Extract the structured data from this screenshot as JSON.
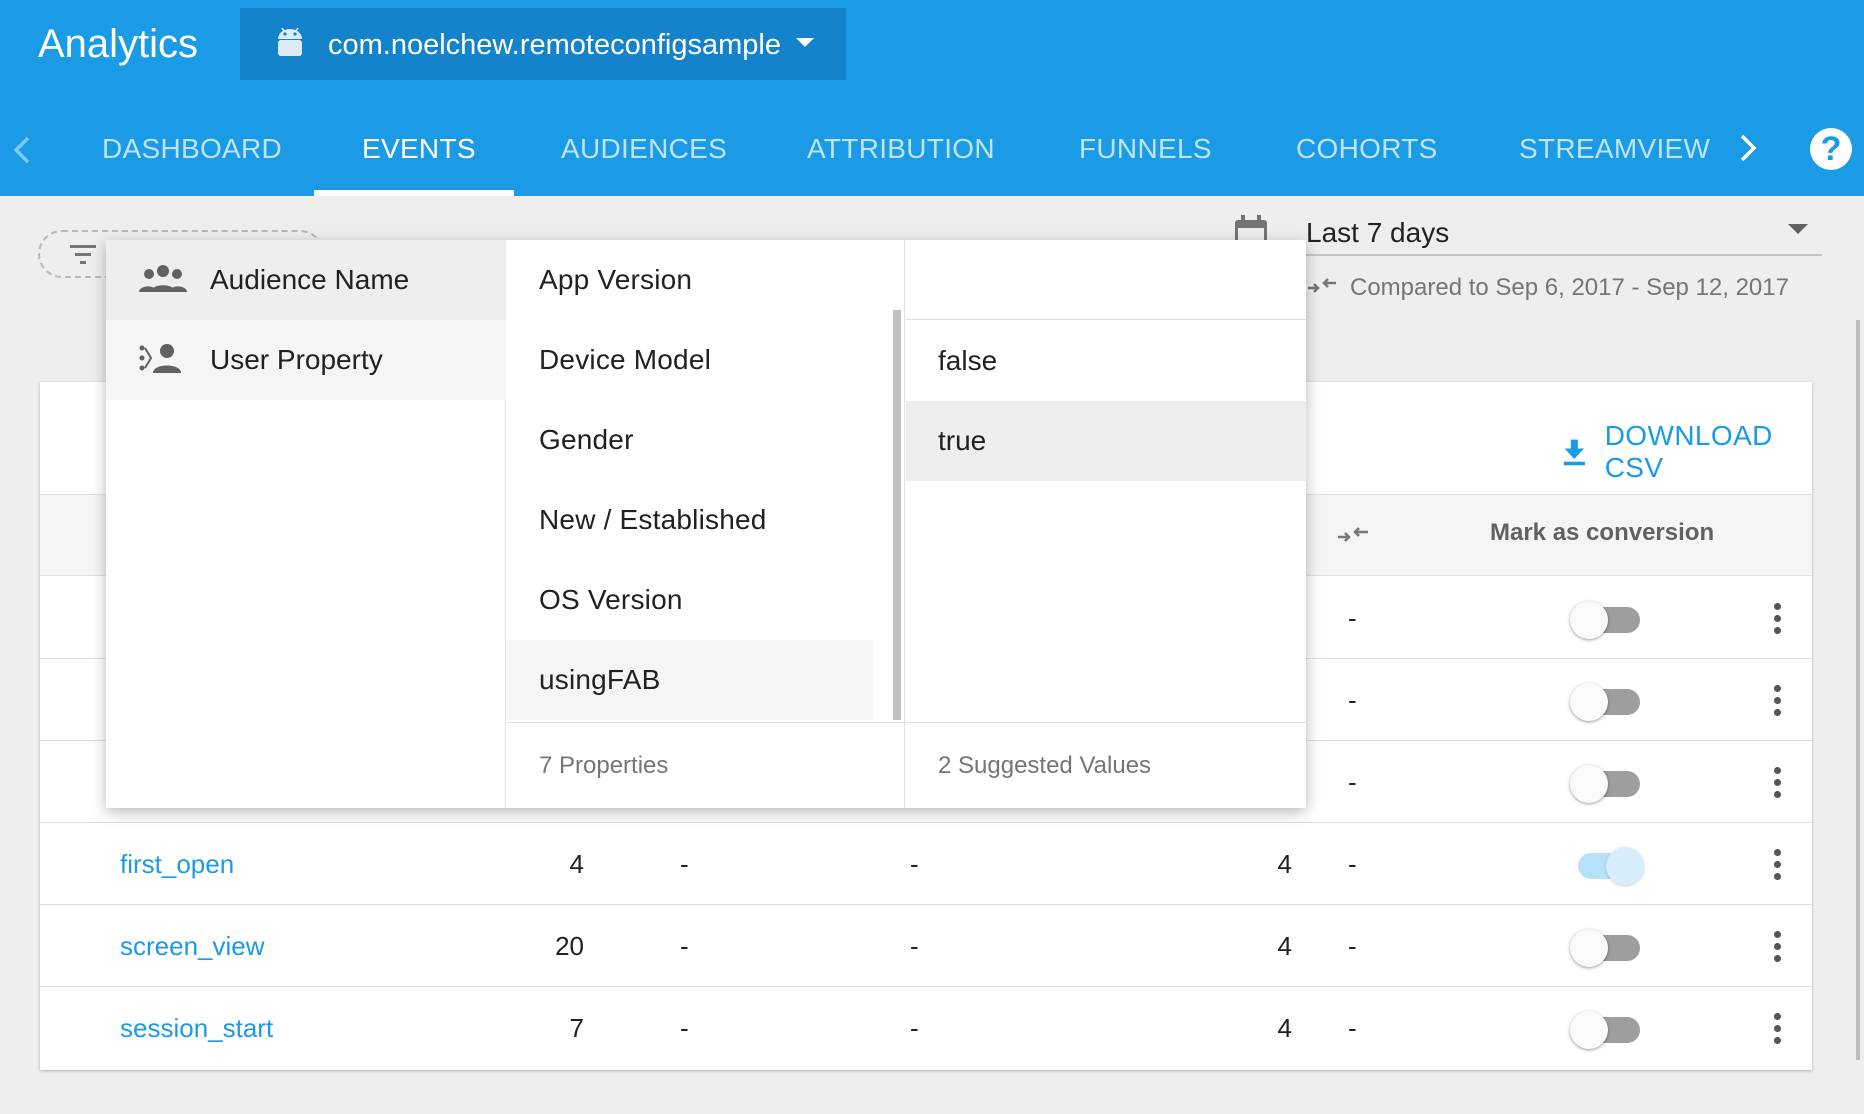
{
  "header": {
    "app_title": "Analytics",
    "app_name": "com.noelchew.remoteconfigsample",
    "tabs": [
      {
        "label": "DASHBOARD"
      },
      {
        "label": "EVENTS"
      },
      {
        "label": "AUDIENCES"
      },
      {
        "label": "ATTRIBUTION"
      },
      {
        "label": "FUNNELS"
      },
      {
        "label": "COHORTS"
      },
      {
        "label": "STREAMVIEW"
      }
    ],
    "active_tab": "EVENTS",
    "help_label": "?"
  },
  "date_filter": {
    "range": "Last 7 days",
    "compared_to": "Compared to Sep 6, 2017 - Sep 12, 2017"
  },
  "events_card": {
    "download_label": "DOWNLOAD CSV",
    "mark_as_conversion_header": "Mark as conversion",
    "rows": [
      {
        "name": "",
        "count": "",
        "d1": "",
        "d2": "",
        "users": "",
        "d3": "-",
        "conversion": false
      },
      {
        "name": "",
        "count": "",
        "d1": "",
        "d2": "",
        "users": "",
        "d3": "-",
        "conversion": false
      },
      {
        "name": "",
        "count": "",
        "d1": "",
        "d2": "",
        "users": "",
        "d3": "-",
        "conversion": false
      },
      {
        "name": "first_open",
        "count": "4",
        "d1": "-",
        "d2": "-",
        "users": "4",
        "d3": "-",
        "conversion": true
      },
      {
        "name": "screen_view",
        "count": "20",
        "d1": "-",
        "d2": "-",
        "users": "4",
        "d3": "-",
        "conversion": false
      },
      {
        "name": "session_start",
        "count": "7",
        "d1": "-",
        "d2": "-",
        "users": "4",
        "d3": "-",
        "conversion": false
      }
    ]
  },
  "filter_dropdown": {
    "categories": [
      {
        "label": "Audience Name",
        "icon": "group-icon"
      },
      {
        "label": "User Property",
        "icon": "user-property-icon"
      }
    ],
    "properties": [
      {
        "label": "App Version"
      },
      {
        "label": "Device Model"
      },
      {
        "label": "Gender"
      },
      {
        "label": "New / Established"
      },
      {
        "label": "OS Version"
      },
      {
        "label": "usingFAB"
      }
    ],
    "properties_footer": "7 Properties",
    "values": [
      {
        "label": "false"
      },
      {
        "label": "true"
      }
    ],
    "values_footer": "2 Suggested Values"
  },
  "colors": {
    "brand_blue": "#1b9be6",
    "header_dark": "#1583cc"
  }
}
